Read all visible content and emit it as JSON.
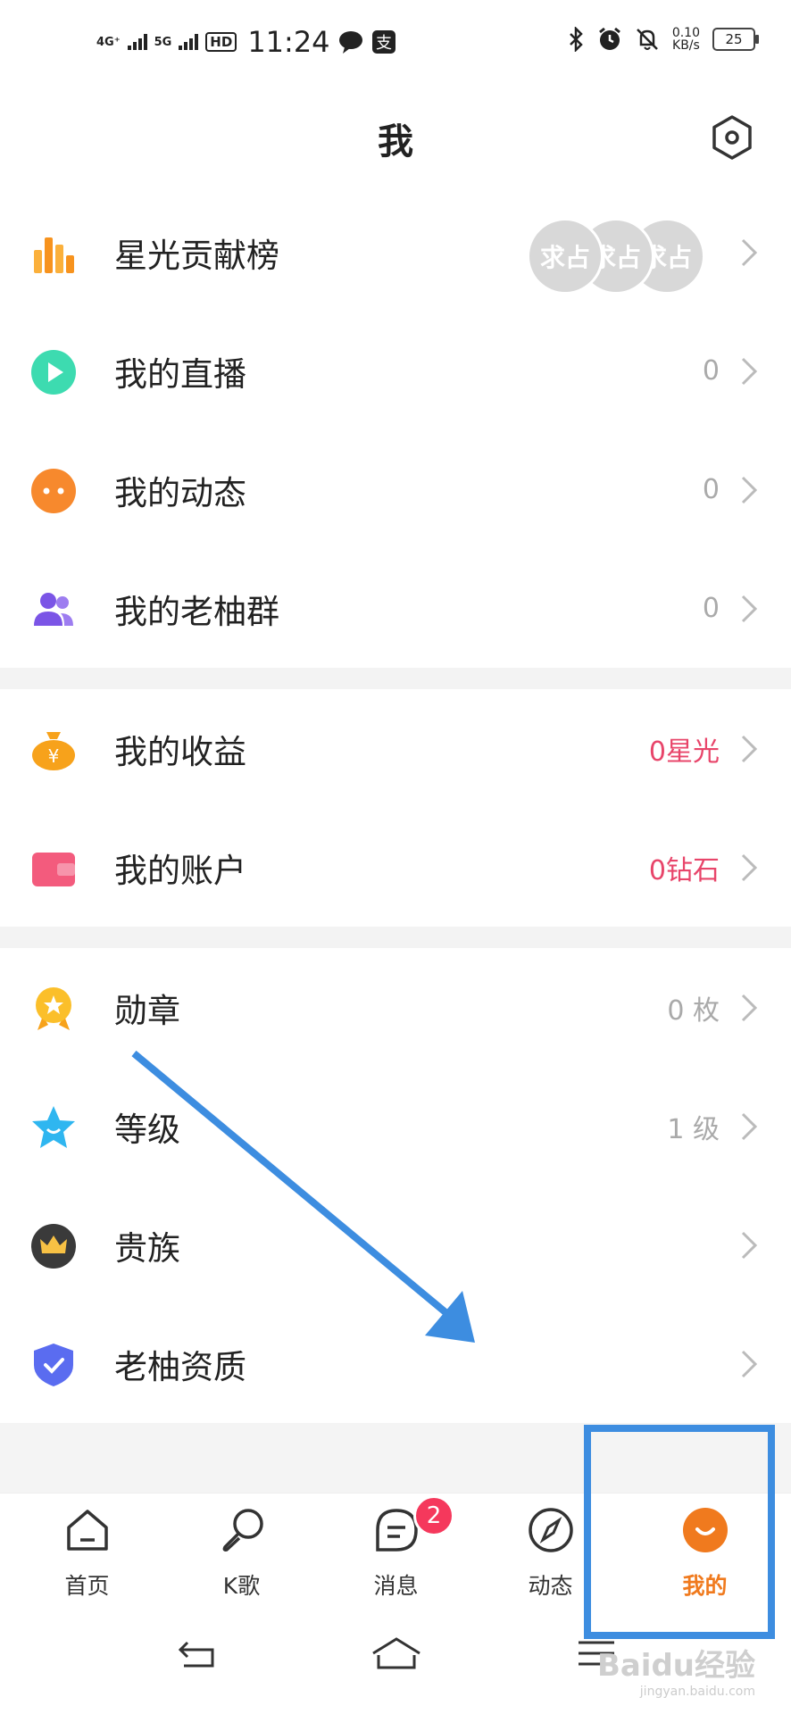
{
  "status_bar": {
    "net1": "4G⁺",
    "net2": "5G",
    "hd": "HD",
    "time": "11:24",
    "speed_value": "0.10",
    "speed_unit": "KB/s",
    "battery": "25"
  },
  "header": {
    "title": "我",
    "settings_icon": "settings-hexagon-icon"
  },
  "group1": {
    "rows": [
      {
        "label": "星光贡献榜",
        "value": "",
        "icon": "bar-chart-icon"
      },
      {
        "label": "我的直播",
        "value": "0",
        "icon": "play-icon"
      },
      {
        "label": "我的动态",
        "value": "0",
        "icon": "chat-bubble-icon"
      },
      {
        "label": "我的老柚群",
        "value": "0",
        "icon": "group-icon"
      }
    ],
    "avatar_text": [
      "求占",
      "求占",
      "求占"
    ]
  },
  "group2": {
    "rows": [
      {
        "label": "我的收益",
        "value": "0星光",
        "icon": "money-bag-icon"
      },
      {
        "label": "我的账户",
        "value": "0钻石",
        "icon": "wallet-icon"
      }
    ]
  },
  "group3": {
    "rows": [
      {
        "label": "勋章",
        "value": "0 枚",
        "icon": "medal-icon"
      },
      {
        "label": "等级",
        "value": "1 级",
        "icon": "star-icon"
      },
      {
        "label": "贵族",
        "value": "",
        "icon": "crown-icon"
      },
      {
        "label": "老柚资质",
        "value": "",
        "icon": "shield-check-icon"
      }
    ]
  },
  "tabbar": {
    "tabs": [
      {
        "label": "首页",
        "icon": "home-icon"
      },
      {
        "label": "K歌",
        "icon": "microphone-icon"
      },
      {
        "label": "消息",
        "icon": "message-icon",
        "badge": "2"
      },
      {
        "label": "动态",
        "icon": "compass-icon"
      },
      {
        "label": "我的",
        "icon": "profile-smile-icon",
        "active": true
      }
    ]
  },
  "watermark": {
    "text": "Baidu经验",
    "sub": "jingyan.baidu.com"
  },
  "colors": {
    "accent_orange": "#f07a1e",
    "pink_value": "#e8456a",
    "highlight_blue": "#3d8de0",
    "badge_red": "#f5385c"
  }
}
